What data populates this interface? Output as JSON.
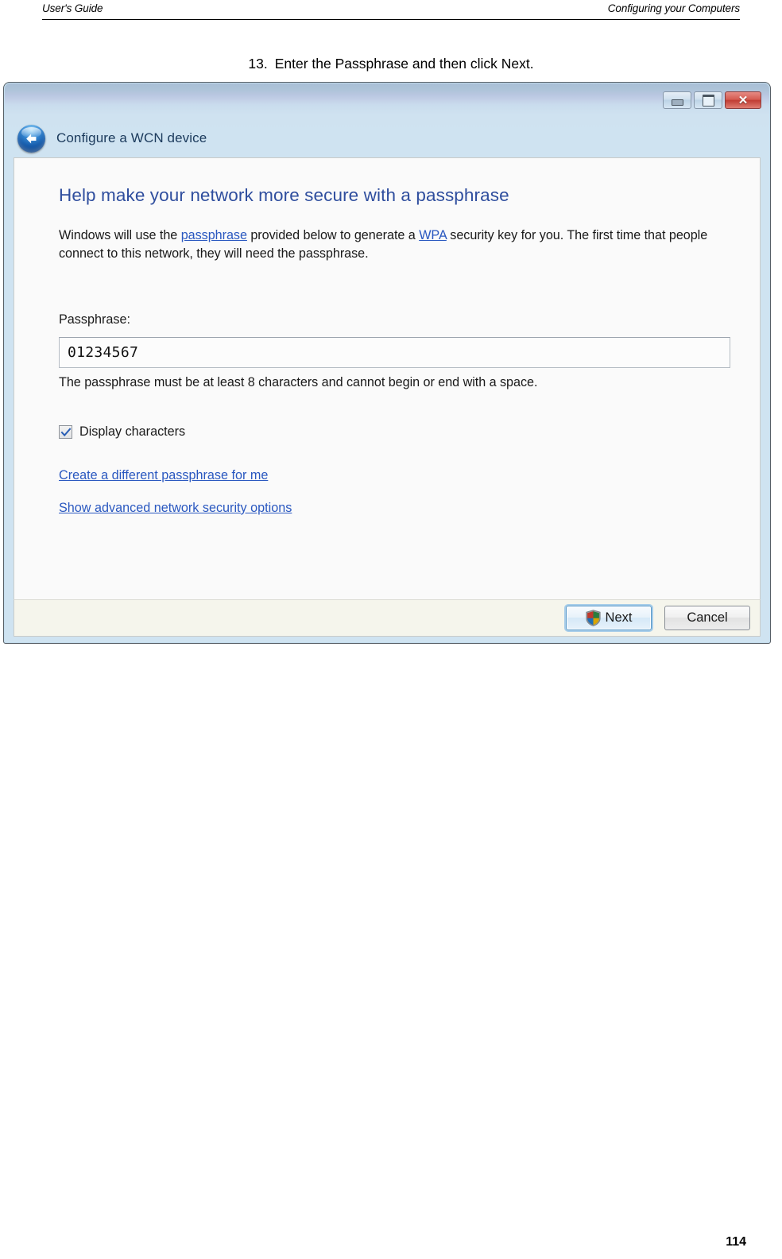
{
  "page": {
    "header_left": "User's Guide",
    "header_right": "Configuring your Computers",
    "page_number": "114"
  },
  "instruction": {
    "number": "13.",
    "text": "Enter the Passphrase and then click Next."
  },
  "dialog": {
    "title": "Configure a WCN device",
    "back_icon": "back-arrow-icon",
    "window_controls": {
      "minimize": "minimize-icon",
      "maximize": "maximize-icon",
      "close": "✕"
    },
    "heading": "Help make your network more secure with a passphrase",
    "intro": {
      "part1": "Windows will use the ",
      "link1": "passphrase",
      "part2": " provided below to generate a ",
      "link2": "WPA",
      "part3": " security key for you. The first time that people connect to this network, they will need the passphrase."
    },
    "passphrase_label": "Passphrase:",
    "passphrase_value": "01234567",
    "passphrase_placeholder": "",
    "hint": "The passphrase must be at least 8 characters and cannot begin or end with a space.",
    "display_characters": {
      "label": "Display characters",
      "checked": true,
      "check_glyph": "✓"
    },
    "links": [
      "Create a different passphrase for me",
      "Show advanced network security options"
    ],
    "buttons": {
      "next": "Next",
      "cancel": "Cancel",
      "next_icon": "uac-shield-icon"
    }
  },
  "colors": {
    "heading": "#2f4e9e",
    "link": "#2a58c0",
    "titlebar_top": "#a9bfd6",
    "titlebar_bottom": "#cfe3f1",
    "close_button": "#c03d34",
    "window_border": "#c3dcec",
    "footer_bg": "#f5f5ec"
  }
}
